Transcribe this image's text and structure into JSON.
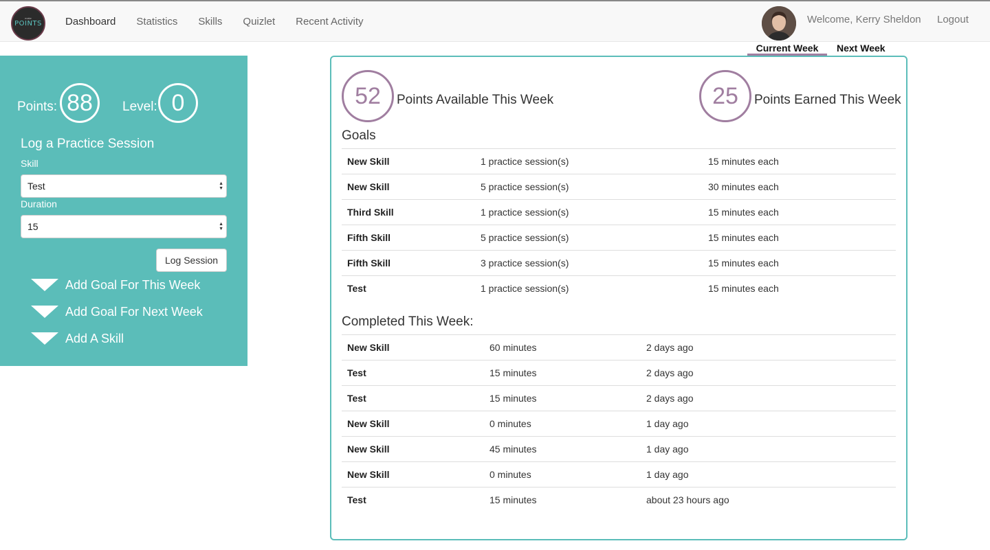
{
  "nav": {
    "logo_small": "make",
    "logo_text": "POINTS",
    "links": [
      "Dashboard",
      "Statistics",
      "Skills",
      "Quizlet",
      "Recent Activity"
    ],
    "welcome": "Welcome, Kerry Sheldon",
    "logout": "Logout"
  },
  "weeks": {
    "current": "Current Week",
    "next": "Next Week"
  },
  "sidebar": {
    "points_label": "Points:",
    "points_value": "88",
    "level_label": "Level:",
    "level_value": "0",
    "log_title": "Log a Practice Session",
    "skill_label": "Skill",
    "skill_value": "Test",
    "duration_label": "Duration",
    "duration_value": "15",
    "log_button": "Log Session",
    "actions": [
      "Add Goal For This Week",
      "Add Goal For Next Week",
      "Add A Skill"
    ]
  },
  "summary": {
    "available_value": "52",
    "available_label": "Points Available This Week",
    "earned_value": "25",
    "earned_label": "Points Earned This Week"
  },
  "goals": {
    "title": "Goals",
    "rows": [
      [
        "New Skill",
        "1 practice session(s)",
        "15 minutes each"
      ],
      [
        "New Skill",
        "5 practice session(s)",
        "30 minutes each"
      ],
      [
        "Third Skill",
        "1 practice session(s)",
        "15 minutes each"
      ],
      [
        "Fifth Skill",
        "5 practice session(s)",
        "15 minutes each"
      ],
      [
        "Fifth Skill",
        "3 practice session(s)",
        "15 minutes each"
      ],
      [
        "Test",
        "1 practice session(s)",
        "15 minutes each"
      ]
    ]
  },
  "completed": {
    "title": "Completed This Week:",
    "rows": [
      [
        "New Skill",
        "60 minutes",
        "2 days ago"
      ],
      [
        "Test",
        "15 minutes",
        "2 days ago"
      ],
      [
        "Test",
        "15 minutes",
        "2 days ago"
      ],
      [
        "New Skill",
        "0 minutes",
        "1 day ago"
      ],
      [
        "New Skill",
        "45 minutes",
        "1 day ago"
      ],
      [
        "New Skill",
        "0 minutes",
        "1 day ago"
      ],
      [
        "Test",
        "15 minutes",
        "about 23 hours ago"
      ]
    ]
  },
  "colors": {
    "teal": "#5bbdb9",
    "purple": "#a07ea0"
  }
}
